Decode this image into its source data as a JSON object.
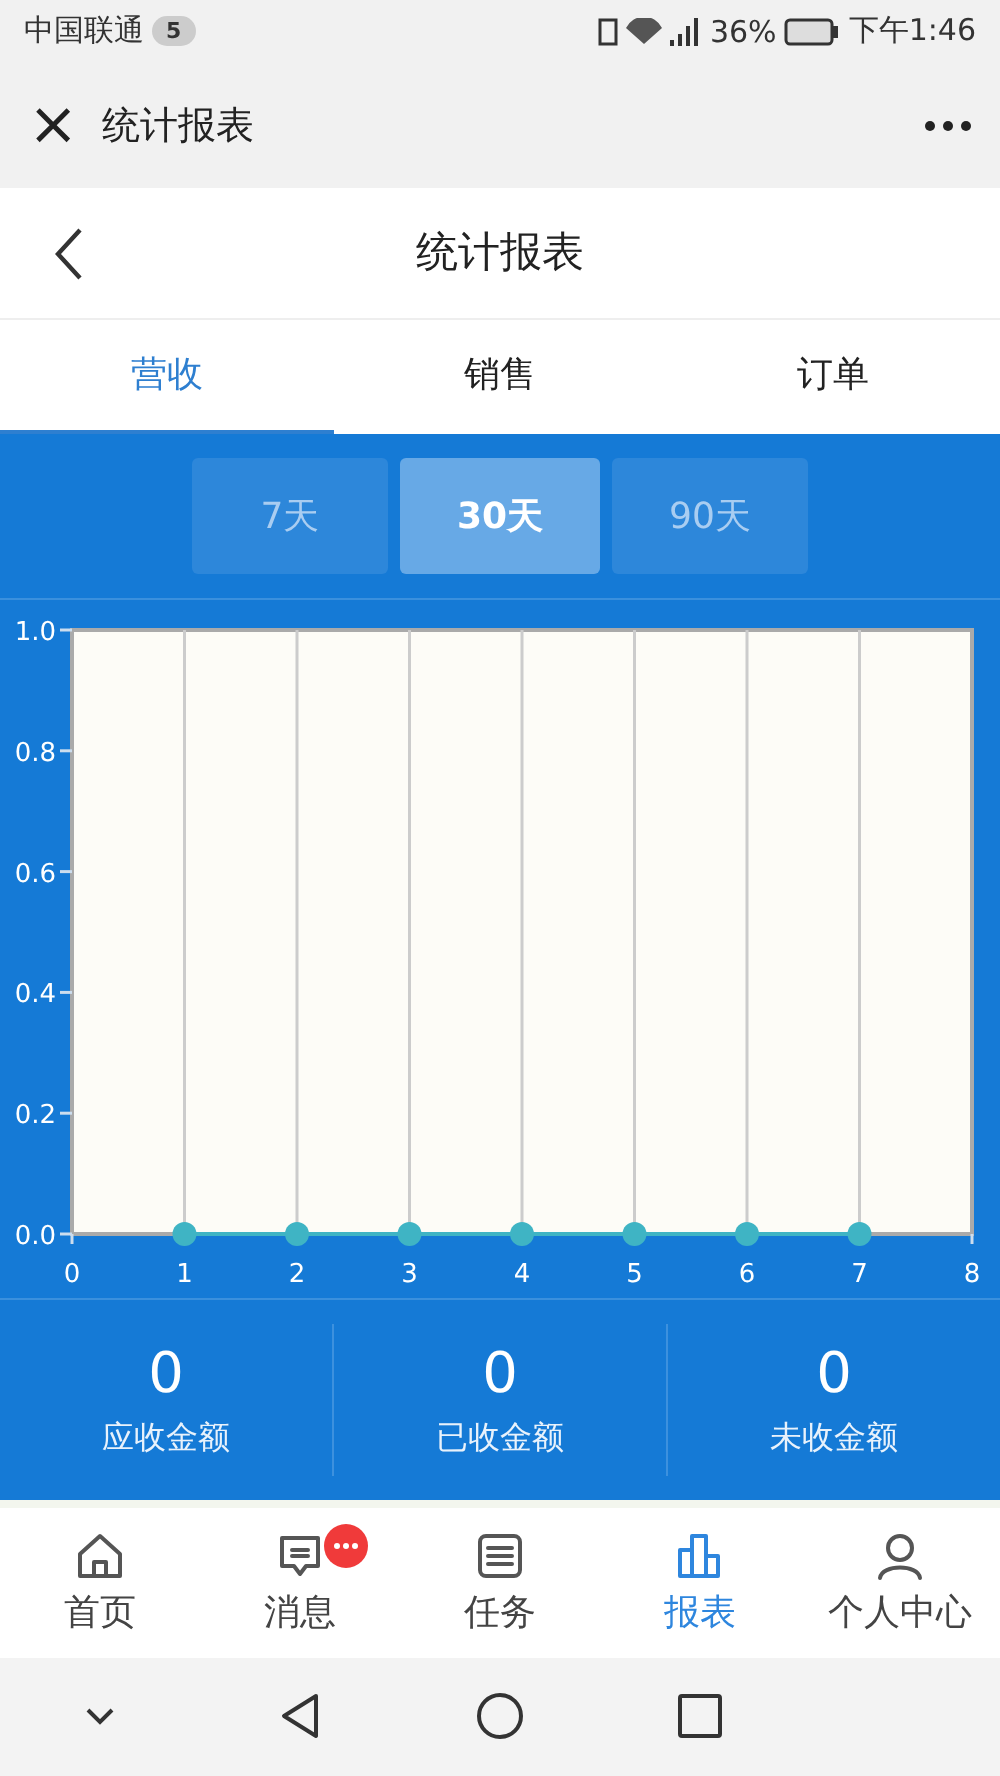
{
  "status_bar": {
    "carrier": "中国联通",
    "notification_count": "5",
    "battery": "36%",
    "time": "下午1:46"
  },
  "webview_bar": {
    "close": "×",
    "title": "统计报表"
  },
  "header": {
    "title": "统计报表"
  },
  "tabs": [
    {
      "label": "营收",
      "selected": true
    },
    {
      "label": "销售",
      "selected": false
    },
    {
      "label": "订单",
      "selected": false
    }
  ],
  "ranges": [
    {
      "label": "7天",
      "selected": false
    },
    {
      "label": "30天",
      "selected": true
    },
    {
      "label": "90天",
      "selected": false
    }
  ],
  "chart_data": {
    "type": "line",
    "x": [
      1,
      2,
      3,
      4,
      5,
      6,
      7
    ],
    "grid": true,
    "series": [
      {
        "color": "#3fb4c4",
        "marker": true,
        "values": [
          0,
          0,
          0,
          0,
          0,
          0,
          0
        ]
      }
    ],
    "xlim": [
      0,
      8
    ],
    "ylim": [
      0,
      1
    ],
    "xticks": [
      0,
      1,
      2,
      3,
      4,
      5,
      6,
      7,
      8
    ],
    "yticks": [
      {
        "value": 0,
        "label": "0.0"
      },
      {
        "value": 0.2,
        "label": "0.2"
      },
      {
        "value": 0.4,
        "label": "0.4"
      },
      {
        "value": 0.6,
        "label": "0.6"
      },
      {
        "value": 0.8,
        "label": "0.8"
      },
      {
        "value": 1,
        "label": "1.0"
      }
    ]
  },
  "summary": [
    {
      "value": "0",
      "label": "应收金额"
    },
    {
      "value": "0",
      "label": "已收金额"
    },
    {
      "value": "0",
      "label": "未收金额"
    }
  ],
  "bottom_nav": [
    {
      "kind": "home",
      "label": "首页",
      "selected": false,
      "badge": false
    },
    {
      "kind": "message",
      "label": "消息",
      "selected": false,
      "badge": true
    },
    {
      "kind": "task",
      "label": "任务",
      "selected": false,
      "badge": false
    },
    {
      "kind": "report",
      "label": "报表",
      "selected": true,
      "badge": false
    },
    {
      "kind": "user",
      "label": "个人中心",
      "selected": false,
      "badge": false
    }
  ]
}
